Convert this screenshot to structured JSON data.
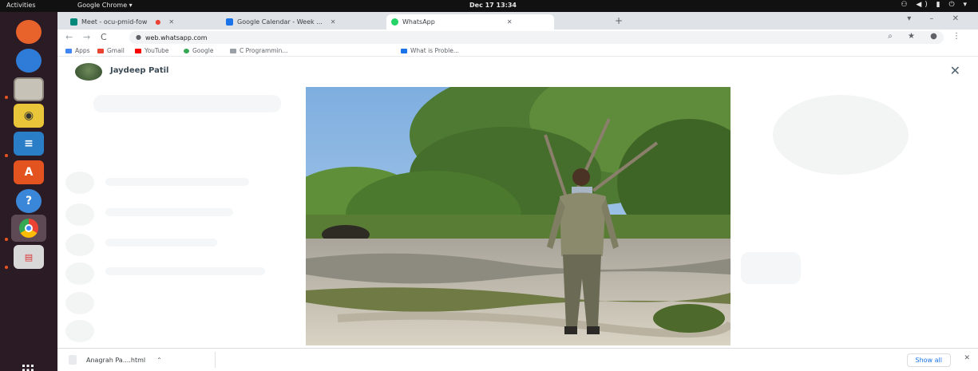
{
  "topbar": {
    "activities": "Activities",
    "app": "Google Chrome ▾",
    "clock": "Dec 17  13:34",
    "status": "⚇ ◀) ▮ ⏻ ▾"
  },
  "dock": {
    "items": [
      {
        "name": "firefox-icon",
        "glyph": "",
        "color": "#e8632b"
      },
      {
        "name": "thunderbird-icon",
        "glyph": "",
        "color": "#2f7bd8"
      },
      {
        "name": "files-icon",
        "glyph": "",
        "color": "#c7c2b7"
      },
      {
        "name": "rhythmbox-icon",
        "glyph": "◉",
        "color": "#e9c53a"
      },
      {
        "name": "libreoffice-writer-icon",
        "glyph": "≡",
        "color": "#2a7ec8"
      },
      {
        "name": "ubuntu-software-icon",
        "glyph": "A",
        "color": "#e2531f"
      },
      {
        "name": "help-icon",
        "glyph": "?",
        "color": "#3a86d8"
      },
      {
        "name": "chrome-icon",
        "glyph": "◎",
        "color": "#7a6a72"
      },
      {
        "name": "impress-icon",
        "glyph": "▤",
        "color": "#d8d8d8"
      }
    ],
    "apps_glyph": "⋮⋮⋮"
  },
  "browser": {
    "tabs": [
      {
        "label": "Meet - ocu-pmid-fow",
        "fav_color": "#00897b",
        "close": "✕"
      },
      {
        "label": "Google Calendar - Week ...",
        "fav_color": "#1a73e8",
        "close": "✕"
      },
      {
        "label": "WhatsApp",
        "fav_color": "#25d366",
        "close": "✕"
      }
    ],
    "new_tab": "+",
    "window_controls": "▾ – ✕",
    "back": "←",
    "forward": "→",
    "reload": "C",
    "url": "web.whatsapp.com",
    "tool_icons": "⌕ ★ ● ⋮",
    "bookmarks": [
      {
        "label": "Apps",
        "color": "#4285f4"
      },
      {
        "label": "Gmail",
        "color": "#ea4335"
      },
      {
        "label": "YouTube",
        "color": "#ff0000"
      },
      {
        "label": "Google",
        "color": "#34a853"
      },
      {
        "label": "C Programmin...",
        "color": "#9aa0a6"
      },
      {
        "label": "What is Proble...",
        "color": "#1a73e8"
      }
    ]
  },
  "viewer": {
    "contact_name": "Jaydeep Patil",
    "close_icon": "✕"
  },
  "download_shelf": {
    "file_name": "Anagrah Pa....html",
    "caret": "⌃",
    "show_all": "Show all",
    "close": "✕"
  }
}
